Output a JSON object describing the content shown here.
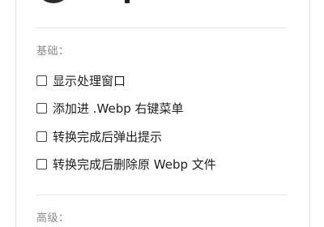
{
  "header": {
    "logo_icon": "app-logo-icon"
  },
  "sections": {
    "basic": {
      "title": "基础：",
      "options": [
        {
          "label": "显示处理窗口",
          "checked": false
        },
        {
          "label": "添加进 .Webp 右键菜单",
          "checked": false
        },
        {
          "label": "转换完成后弹出提示",
          "checked": false
        },
        {
          "label": "转换完成后删除原 Webp 文件",
          "checked": false
        }
      ]
    },
    "advanced": {
      "title": "高级："
    }
  },
  "colors": {
    "logo_dark": "#2b2b2b",
    "logo_yellow": "#f5c518",
    "divider": "#e6e6e6",
    "section_title": "#8a8a8a"
  }
}
